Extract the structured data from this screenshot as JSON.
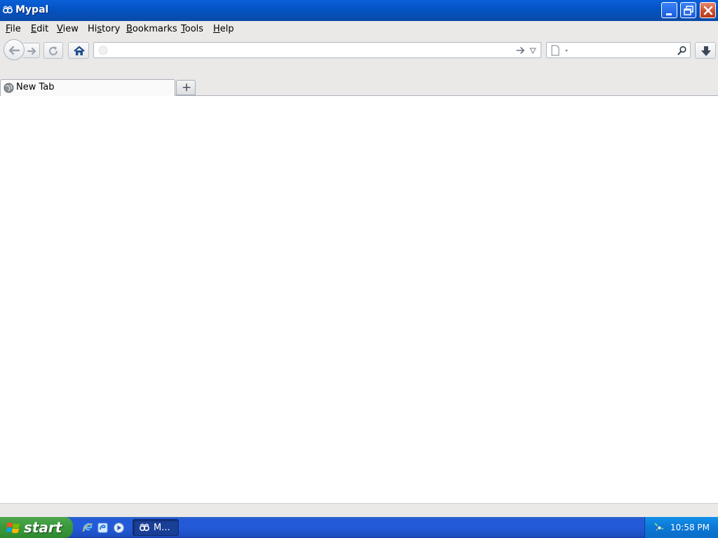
{
  "window": {
    "title": "Mypal",
    "icon": "mypal-app-icon",
    "controls": [
      "minimize",
      "maximize",
      "close"
    ]
  },
  "menubar": {
    "items": [
      {
        "label": "File",
        "accel": "F",
        "rest": "ile"
      },
      {
        "label": "Edit",
        "accel": "E",
        "rest": "dit"
      },
      {
        "label": "View",
        "accel": "V",
        "rest": "iew"
      },
      {
        "label": "History",
        "accel": "s",
        "pre": "Hi",
        "rest": "tory"
      },
      {
        "label": "Bookmarks",
        "accel": "B",
        "rest": "ookmarks"
      },
      {
        "label": "Tools",
        "accel": "T",
        "rest": "ools"
      },
      {
        "label": "Help",
        "accel": "H",
        "rest": "elp"
      }
    ]
  },
  "navbar": {
    "back_icon": "back-arrow-icon",
    "forward_icon": "forward-arrow-icon",
    "reload_icon": "reload-icon",
    "home_icon": "home-icon",
    "url": {
      "value": "",
      "placeholder": ""
    },
    "search": {
      "value": "",
      "placeholder": ""
    },
    "download_icon": "download-arrow-icon"
  },
  "tabs": [
    {
      "label": "New Tab",
      "icon": "globe-icon",
      "selected": true
    }
  ],
  "new_tab_symbol": "+",
  "taskbar": {
    "start_label": "start",
    "quick_launch": [
      "internet-explorer-icon",
      "show-desktop-icon",
      "media-player-icon"
    ],
    "tasks": [
      {
        "label": "M...",
        "icon": "mypal-app-icon",
        "active": true
      }
    ],
    "clock": "10:58 PM",
    "tray_icons": [
      "network-icon"
    ]
  },
  "colors": {
    "titlebar": "#0553c6",
    "taskbar": "#245ad6",
    "start": "#3b9a3b",
    "tray": "#0b77d6",
    "chrome_bg": "#eae9e8",
    "close_button": "#c94a2c"
  }
}
